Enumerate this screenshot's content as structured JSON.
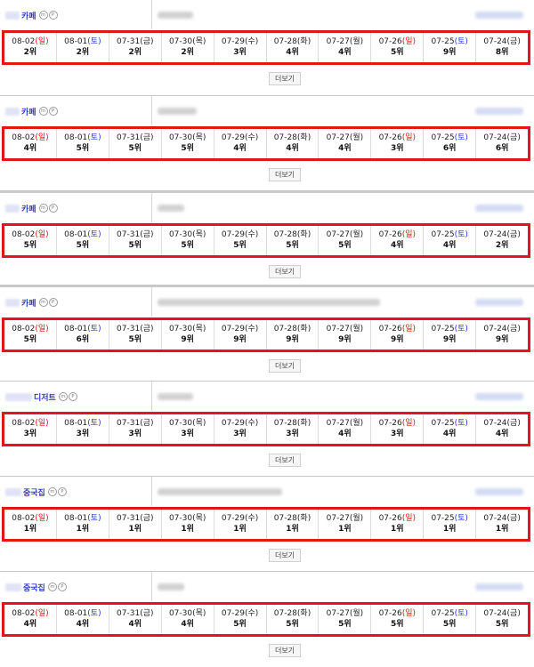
{
  "colors": {
    "highlight_border": "#e5141a",
    "sunday": "#e01515",
    "saturday": "#2b39c9",
    "keyword": "#2f3cbd"
  },
  "more_label": "더보기",
  "days": [
    {
      "date": "08-02",
      "day": "(일)",
      "type": "sun"
    },
    {
      "date": "08-01",
      "day": "(토)",
      "type": "sat"
    },
    {
      "date": "07-31",
      "day": "(금)",
      "type": ""
    },
    {
      "date": "07-30",
      "day": "(목)",
      "type": ""
    },
    {
      "date": "07-29",
      "day": "(수)",
      "type": ""
    },
    {
      "date": "07-28",
      "day": "(화)",
      "type": ""
    },
    {
      "date": "07-27",
      "day": "(월)",
      "type": ""
    },
    {
      "date": "07-26",
      "day": "(일)",
      "type": "sun"
    },
    {
      "date": "07-25",
      "day": "(토)",
      "type": "sat"
    },
    {
      "date": "07-24",
      "day": "(금)",
      "type": ""
    }
  ],
  "blocks": [
    {
      "keyword": "카페",
      "badges": [
        "m",
        "P"
      ],
      "ranks": [
        "2위",
        "2위",
        "2위",
        "2위",
        "3위",
        "4위",
        "4위",
        "5위",
        "9위",
        "8위"
      ]
    },
    {
      "keyword": "카페",
      "badges": [
        "m",
        "P"
      ],
      "ranks": [
        "4위",
        "5위",
        "5위",
        "5위",
        "4위",
        "4위",
        "4위",
        "3위",
        "6위",
        "6위"
      ]
    },
    {
      "keyword": "카페",
      "badges": [
        "m",
        "P"
      ],
      "ranks": [
        "5위",
        "5위",
        "5위",
        "5위",
        "5위",
        "5위",
        "5위",
        "4위",
        "4위",
        "2위"
      ]
    },
    {
      "keyword": "카페",
      "badges": [
        "m",
        "P"
      ],
      "ranks": [
        "5위",
        "6위",
        "5위",
        "9위",
        "9위",
        "9위",
        "9위",
        "9위",
        "9위",
        "9위"
      ]
    },
    {
      "keyword": "디저트",
      "badges": [
        "m",
        "P"
      ],
      "ranks": [
        "3위",
        "3위",
        "3위",
        "3위",
        "3위",
        "3위",
        "4위",
        "3위",
        "4위",
        "4위"
      ]
    },
    {
      "keyword": "중국집",
      "badges": [
        "m",
        "P"
      ],
      "ranks": [
        "1위",
        "1위",
        "1위",
        "1위",
        "1위",
        "1위",
        "1위",
        "1위",
        "1위",
        "1위"
      ]
    },
    {
      "keyword": "중국집",
      "badges": [
        "m",
        "P"
      ],
      "ranks": [
        "4위",
        "4위",
        "4위",
        "4위",
        "5위",
        "5위",
        "5위",
        "5위",
        "5위",
        "5위"
      ]
    }
  ]
}
